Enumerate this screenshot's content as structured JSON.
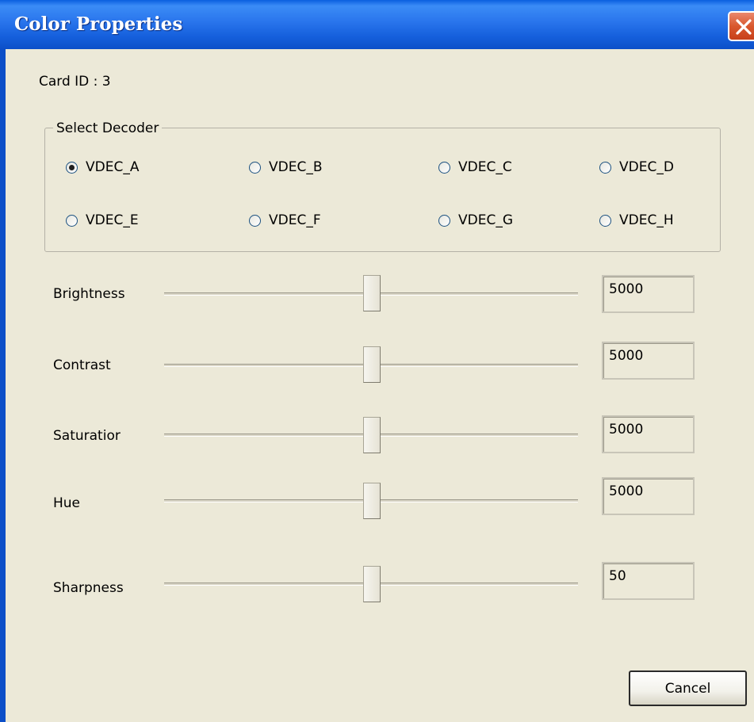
{
  "window": {
    "title": "Color Properties"
  },
  "card_id": "Card ID : 3",
  "decoder_group": {
    "label": "Select Decoder",
    "options": [
      "VDEC_A",
      "VDEC_B",
      "VDEC_C",
      "VDEC_D",
      "VDEC_E",
      "VDEC_F",
      "VDEC_G",
      "VDEC_H"
    ],
    "selected": "VDEC_A"
  },
  "sliders": [
    {
      "label": "Brightness",
      "value": "5000",
      "position": 0.5
    },
    {
      "label": "Contrast",
      "value": "5000",
      "position": 0.5
    },
    {
      "label": "Saturatior",
      "value": "5000",
      "position": 0.5
    },
    {
      "label": "Hue",
      "value": "5000",
      "position": 0.5
    },
    {
      "label": "Sharpness",
      "value": "50",
      "position": 0.5
    }
  ],
  "buttons": {
    "cancel": "Cancel"
  },
  "icons": {
    "close": "close-icon"
  }
}
